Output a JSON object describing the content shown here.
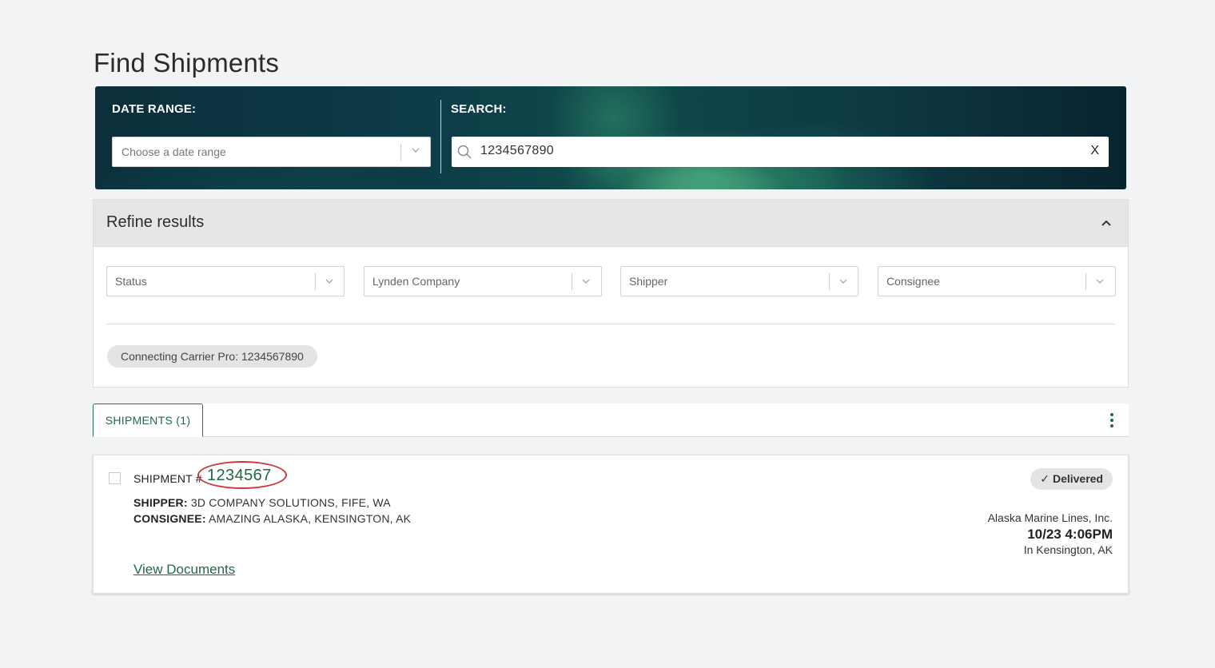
{
  "page": {
    "title": "Find Shipments"
  },
  "search_banner": {
    "date_label": "DATE RANGE:",
    "date_placeholder": "Choose a date range",
    "search_label": "SEARCH:",
    "search_value": "1234567890",
    "clear_label": "X"
  },
  "refine": {
    "title": "Refine results",
    "filters": [
      "Status",
      "Lynden Company",
      "Shipper",
      "Consignee"
    ],
    "active_chip": "Connecting Carrier Pro: 1234567890"
  },
  "tabs": {
    "shipments": "SHIPMENTS (1)"
  },
  "shipment": {
    "label": "SHIPMENT #",
    "number": "1234567",
    "shipper_label": "SHIPPER:",
    "shipper_value": "3D COMPANY SOLUTIONS, FIFE, WA",
    "consignee_label": "CONSIGNEE:",
    "consignee_value": "AMAZING ALASKA, KENSINGTON, AK",
    "view_documents": "View Documents",
    "status": "Delivered",
    "carrier": "Alaska Marine Lines, Inc.",
    "datetime": "10/23 4:06PM",
    "location": "In Kensington, AK"
  },
  "colors": {
    "brand_green": "#1f6a44",
    "annotation_red": "#c83a3a"
  },
  "icons": [
    "chevron-down-icon",
    "search-icon",
    "chevron-up-icon",
    "kebab-menu-icon",
    "checkmark-icon"
  ]
}
